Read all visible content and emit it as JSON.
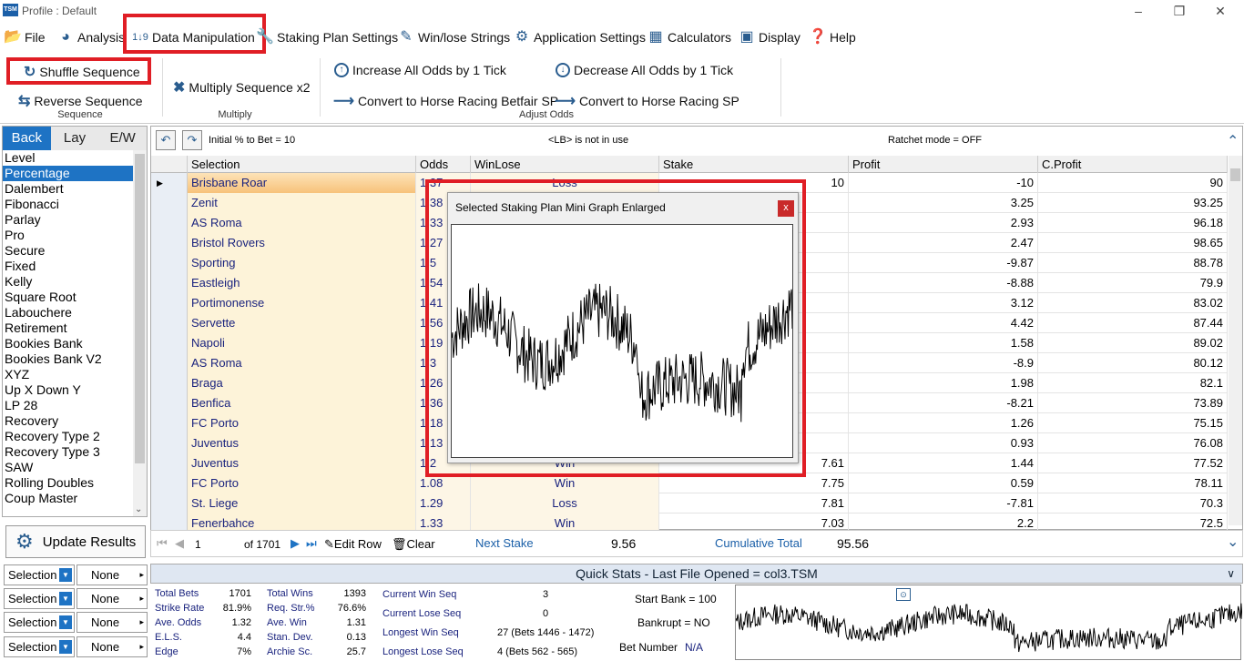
{
  "window": {
    "title": "Profile : Default",
    "logo": "TSM"
  },
  "menu": [
    "File",
    "Analysis",
    "Data Manipulation",
    "Staking Plan Settings",
    "Win/lose Strings",
    "Application Settings",
    "Calculators",
    "Display",
    "Help"
  ],
  "ribbon": {
    "shuffle": "Shuffle Sequence",
    "reverse": "Reverse Sequence",
    "group_sequence": "Sequence",
    "multiply": "Multiply Sequence x2",
    "group_multiply": "Multiply",
    "increase": "Increase All Odds by 1 Tick",
    "decrease": "Decrease All Odds by 1 Tick",
    "convert_betfair": "Convert to Horse Racing Betfair SP",
    "convert_horse": "Convert to Horse Racing SP",
    "group_adjust": "Adjust Odds"
  },
  "left": {
    "tabs": [
      "Back",
      "Lay",
      "E/W"
    ],
    "plans": [
      "Level",
      "Percentage",
      "Dalembert",
      "Fibonacci",
      "Parlay",
      "Pro",
      "Secure",
      "Fixed",
      "Kelly",
      "Square Root",
      "Labouchere",
      "Retirement",
      "Bookies Bank",
      "Bookies Bank V2",
      "XYZ",
      "Up X Down Y",
      "LP 28",
      "Recovery",
      "Recovery Type 2",
      "Recovery Type 3",
      "SAW",
      "Rolling Doubles",
      "Coup Master"
    ],
    "selected_plan": "Percentage",
    "update": "Update Results",
    "selectors": [
      {
        "a": "Selection",
        "b": "None"
      },
      {
        "a": "Selection",
        "b": "None"
      },
      {
        "a": "Selection",
        "b": "None"
      },
      {
        "a": "Selection",
        "b": "None"
      }
    ]
  },
  "grid": {
    "initial": "Initial % to Bet = 10",
    "lb": "<LB> is not in use",
    "ratchet": "Ratchet mode = OFF",
    "headers": [
      "Selection",
      "Odds",
      "WinLose",
      "Stake",
      "Profit",
      "C.Profit"
    ],
    "rows": [
      {
        "sel": "Brisbane Roar",
        "odds": "1.37",
        "wl": "Loss",
        "stake": "10",
        "profit": "-10",
        "cprof": "90"
      },
      {
        "sel": "Zenit",
        "odds": "1.38",
        "wl": "",
        "stake": "",
        "profit": "3.25",
        "cprof": "93.25"
      },
      {
        "sel": "AS Roma",
        "odds": "1.33",
        "wl": "",
        "stake": "",
        "profit": "2.93",
        "cprof": "96.18"
      },
      {
        "sel": "Bristol Rovers",
        "odds": "1.27",
        "wl": "",
        "stake": "",
        "profit": "2.47",
        "cprof": "98.65"
      },
      {
        "sel": "Sporting",
        "odds": "1.5",
        "wl": "",
        "stake": "",
        "profit": "-9.87",
        "cprof": "88.78"
      },
      {
        "sel": "Eastleigh",
        "odds": "1.54",
        "wl": "",
        "stake": "",
        "profit": "-8.88",
        "cprof": "79.9"
      },
      {
        "sel": "Portimonense",
        "odds": "1.41",
        "wl": "",
        "stake": "",
        "profit": "3.12",
        "cprof": "83.02"
      },
      {
        "sel": "Servette",
        "odds": "1.56",
        "wl": "",
        "stake": "",
        "profit": "4.42",
        "cprof": "87.44"
      },
      {
        "sel": "Napoli",
        "odds": "1.19",
        "wl": "",
        "stake": "",
        "profit": "1.58",
        "cprof": "89.02"
      },
      {
        "sel": "AS Roma",
        "odds": "1.3",
        "wl": "",
        "stake": "",
        "profit": "-8.9",
        "cprof": "80.12"
      },
      {
        "sel": "Braga",
        "odds": "1.26",
        "wl": "",
        "stake": "",
        "profit": "1.98",
        "cprof": "82.1"
      },
      {
        "sel": "Benfica",
        "odds": "1.36",
        "wl": "",
        "stake": "",
        "profit": "-8.21",
        "cprof": "73.89"
      },
      {
        "sel": "FC Porto",
        "odds": "1.18",
        "wl": "",
        "stake": "",
        "profit": "1.26",
        "cprof": "75.15"
      },
      {
        "sel": "Juventus",
        "odds": "1.13",
        "wl": "",
        "stake": "",
        "profit": "0.93",
        "cprof": "76.08"
      },
      {
        "sel": "Juventus",
        "odds": "1.2",
        "wl": "Win",
        "stake": "7.61",
        "profit": "1.44",
        "cprof": "77.52"
      },
      {
        "sel": "FC Porto",
        "odds": "1.08",
        "wl": "Win",
        "stake": "7.75",
        "profit": "0.59",
        "cprof": "78.11"
      },
      {
        "sel": "St. Liege",
        "odds": "1.29",
        "wl": "Loss",
        "stake": "7.81",
        "profit": "-7.81",
        "cprof": "70.3"
      },
      {
        "sel": "Fenerbahce",
        "odds": "1.33",
        "wl": "Win",
        "stake": "7.03",
        "profit": "2.2",
        "cprof": "72.5"
      }
    ]
  },
  "nav": {
    "record": "1",
    "of": "of 1701",
    "edit": "Edit Row",
    "clear": "Clear",
    "next_label": "Next Stake",
    "next_val": "9.56",
    "cum_label": "Cumulative Total",
    "cum_val": "95.56"
  },
  "quick": {
    "title": "Quick Stats - Last File Opened = col3.TSM",
    "col1": [
      [
        "Total Bets",
        "1701"
      ],
      [
        "Strike Rate",
        "81.9%"
      ],
      [
        "Ave. Odds",
        "1.32"
      ],
      [
        "E.L.S.",
        "4.4"
      ],
      [
        "Edge",
        "7%"
      ]
    ],
    "col2": [
      [
        "Total Wins",
        "1393"
      ],
      [
        "Req. Str.%",
        "76.6%"
      ],
      [
        "Ave. Win",
        "1.31"
      ],
      [
        "Stan. Dev.",
        "0.13"
      ],
      [
        "Archie Sc.",
        "25.7"
      ]
    ],
    "seq": [
      [
        "Current Win Seq",
        "3"
      ],
      [
        "Current Lose Seq",
        "0"
      ],
      [
        "Longest Win Seq",
        "27  (Bets 1446 - 1472)"
      ],
      [
        "Longest Lose Seq",
        "4  (Bets 562 - 565)"
      ]
    ],
    "start_bank": "Start Bank = 100",
    "bankrupt": "Bankrupt = NO",
    "bet_number_label": "Bet Number",
    "bet_number_val": "N/A"
  },
  "popup": {
    "title": "Selected Staking Plan Mini Graph Enlarged",
    "close": "x"
  }
}
